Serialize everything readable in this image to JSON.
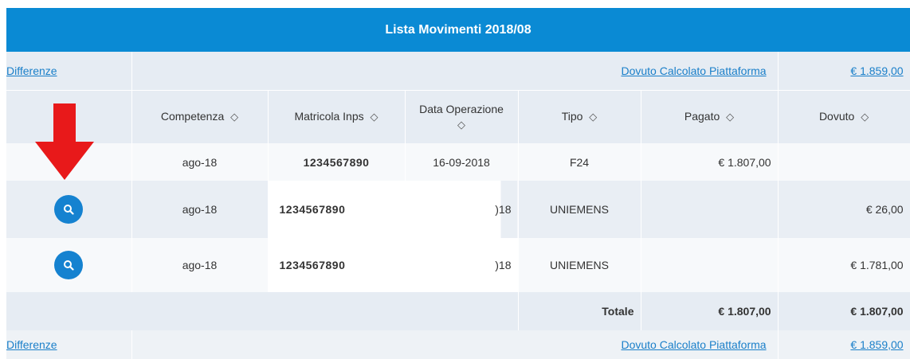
{
  "title": "Lista Movimenti 2018/08",
  "summary_top": {
    "left_link": "Differenze",
    "label_link": "Dovuto Calcolato Piattaforma",
    "value_link": "€ 1.859,00"
  },
  "columns": {
    "competenza": "Competenza",
    "matricola": "Matricola Inps",
    "data_operazione": "Data Operazione",
    "tipo": "Tipo",
    "pagato": "Pagato",
    "dovuto": "Dovuto",
    "sort_glyph": "◇"
  },
  "rows": [
    {
      "competenza": "ago-18",
      "matricola": "1234567890",
      "data": "16-09-2018",
      "tipo": "F24",
      "pagato": "€ 1.807,00",
      "dovuto": ""
    },
    {
      "competenza": "ago-18",
      "matricola": "1234567890",
      "data": ")18",
      "tipo": "UNIEMENS",
      "pagato": "",
      "dovuto": "€ 26,00"
    },
    {
      "competenza": "ago-18",
      "matricola": "1234567890",
      "data": ")18",
      "tipo": "UNIEMENS",
      "pagato": "",
      "dovuto": "€ 1.781,00"
    }
  ],
  "totale": {
    "label": "Totale",
    "pagato": "€ 1.807,00",
    "dovuto": "€ 1.807,00"
  },
  "summary_bottom": {
    "left_link": "Differenze",
    "label_link": "Dovuto Calcolato Piattaforma",
    "value_link": "€ 1.859,00"
  },
  "colors": {
    "title_bar": "#0a8ad4",
    "row_shade": "#e6ecf3",
    "link": "#1a7fc9",
    "arrow": "#e8191a",
    "action_button": "#1582d0"
  }
}
